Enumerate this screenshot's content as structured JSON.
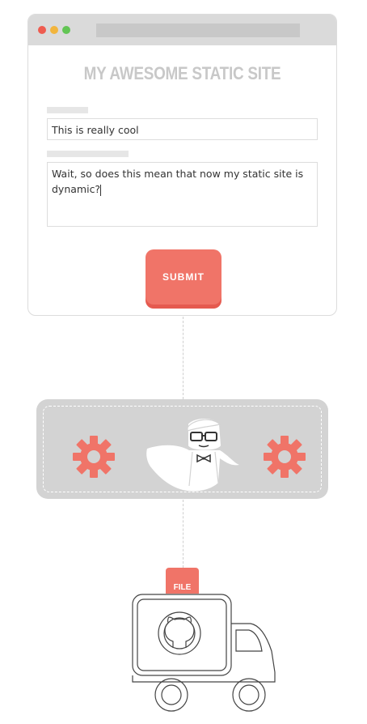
{
  "site": {
    "title": "MY AWESOME STATIC SITE"
  },
  "form": {
    "input_value": "This is really cool",
    "textarea_value": "Wait, so does this mean that now my static site is dynamic?",
    "submit_label": "SUBMIT"
  },
  "file": {
    "label": "FILE"
  },
  "colors": {
    "accent": "#f07468",
    "window_chrome": "#dadada",
    "title_text": "#c8c8c8",
    "processor_bg": "#d3d3d3"
  },
  "icons": {
    "traffic_lights": [
      "close-dot",
      "minimize-dot",
      "zoom-dot"
    ],
    "left_gear": "gear-icon",
    "right_gear": "gear-icon",
    "mascot": "caped-hero-mascot-icon",
    "truck": "delivery-truck-icon",
    "repo_logo": "github-octocat-icon"
  }
}
